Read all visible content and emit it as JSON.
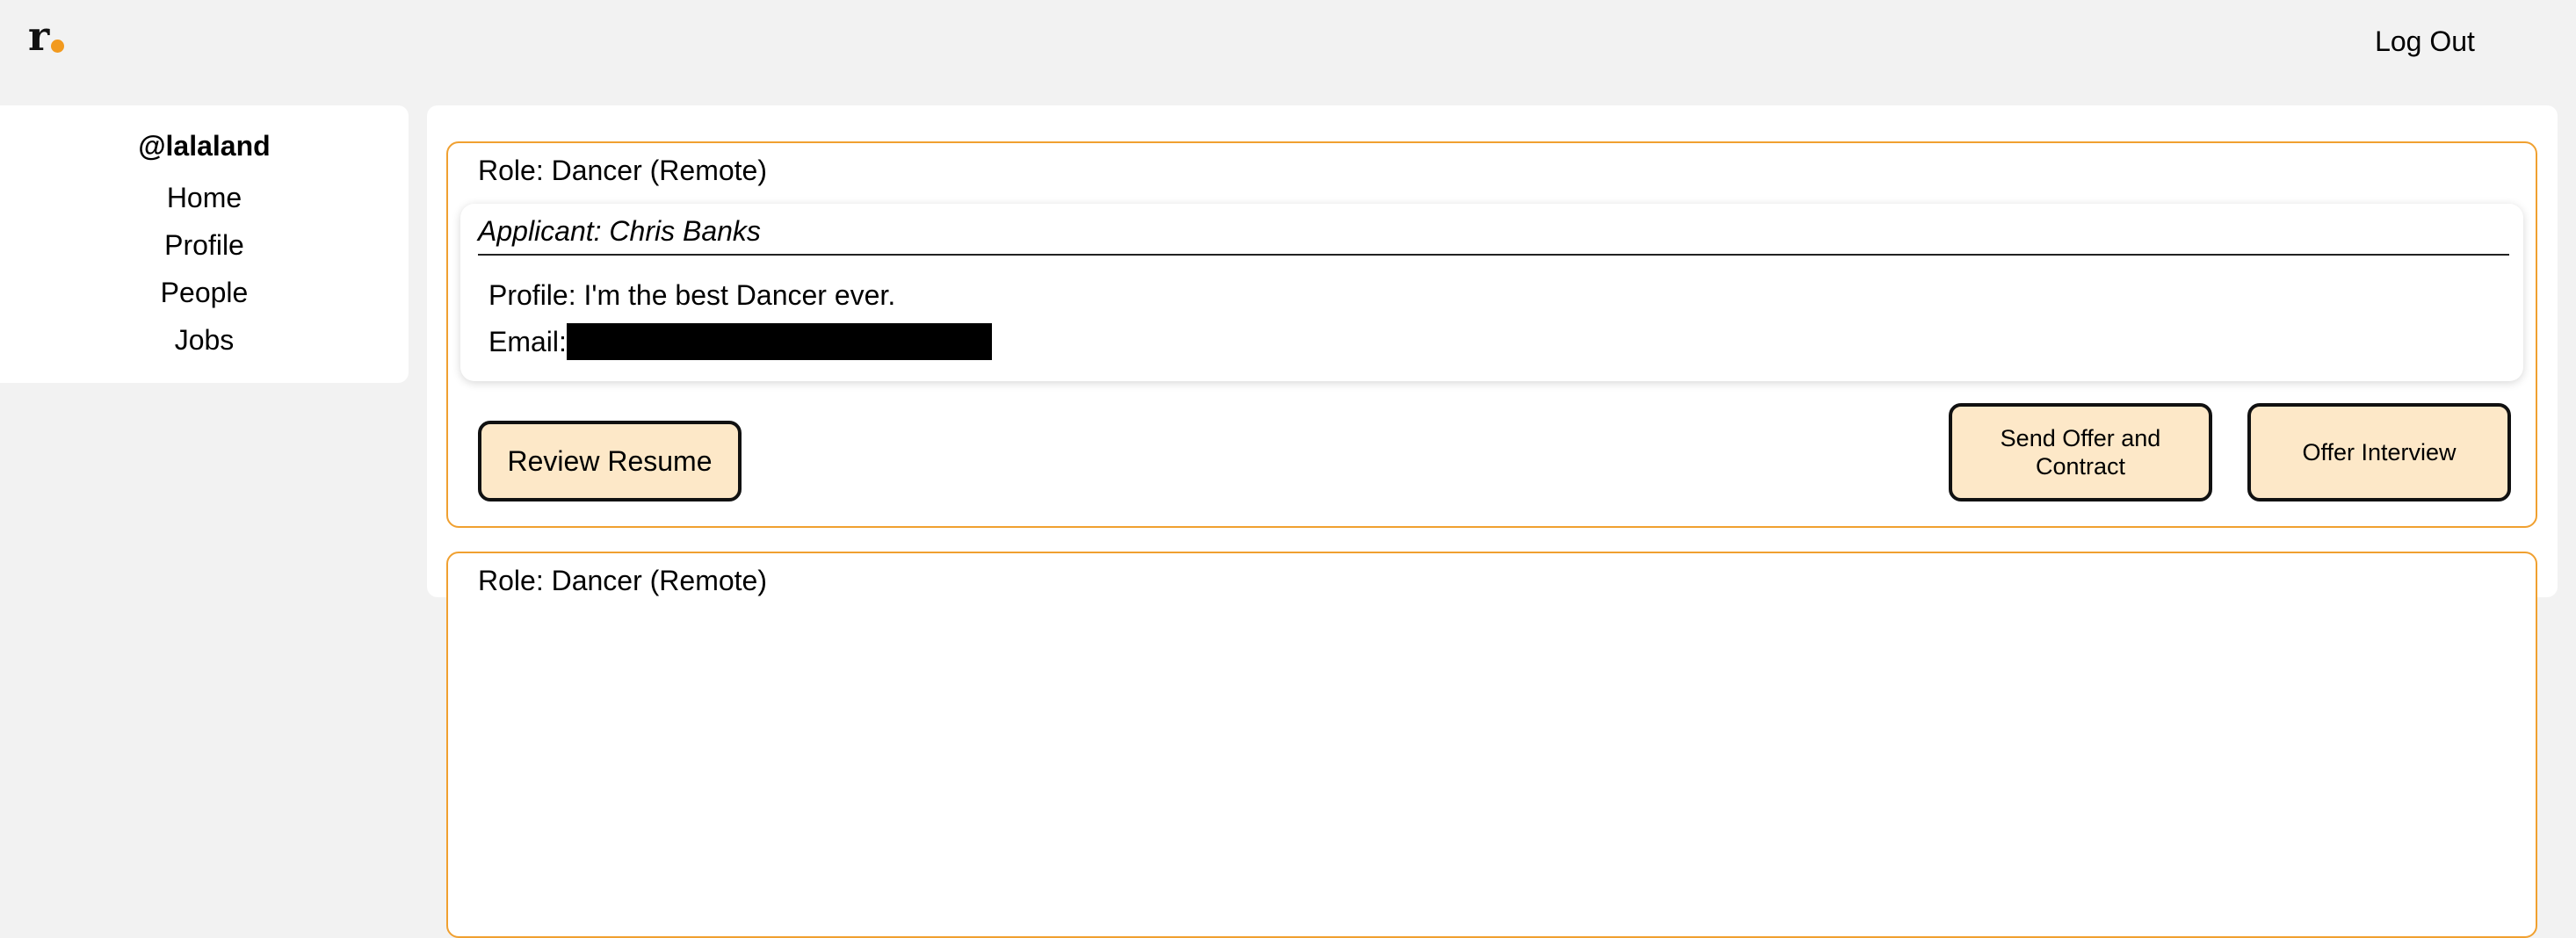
{
  "header": {
    "logo_letter": "r",
    "logout_label": "Log Out"
  },
  "sidebar": {
    "username": "@lalaland",
    "items": [
      {
        "label": "Home"
      },
      {
        "label": "Profile"
      },
      {
        "label": "People"
      },
      {
        "label": "Jobs"
      }
    ]
  },
  "applications": [
    {
      "role_prefix": "Role: ",
      "role": "Dancer",
      "location": "(Remote)",
      "applicant": "Applicant: Chris Banks",
      "profile": "Profile: I'm the best Dancer ever.",
      "email_label": "Email:",
      "review_label": "Review Resume",
      "send_offer_label": "Send Offer and Contract",
      "offer_interview_label": "Offer Interview"
    },
    {
      "role_prefix": "Role: ",
      "role": "Dancer",
      "location": "(Remote)"
    }
  ],
  "colors": {
    "accent": "#f0a030",
    "button_fill": "#fde8c8",
    "page_background": "#f2f2f2"
  }
}
